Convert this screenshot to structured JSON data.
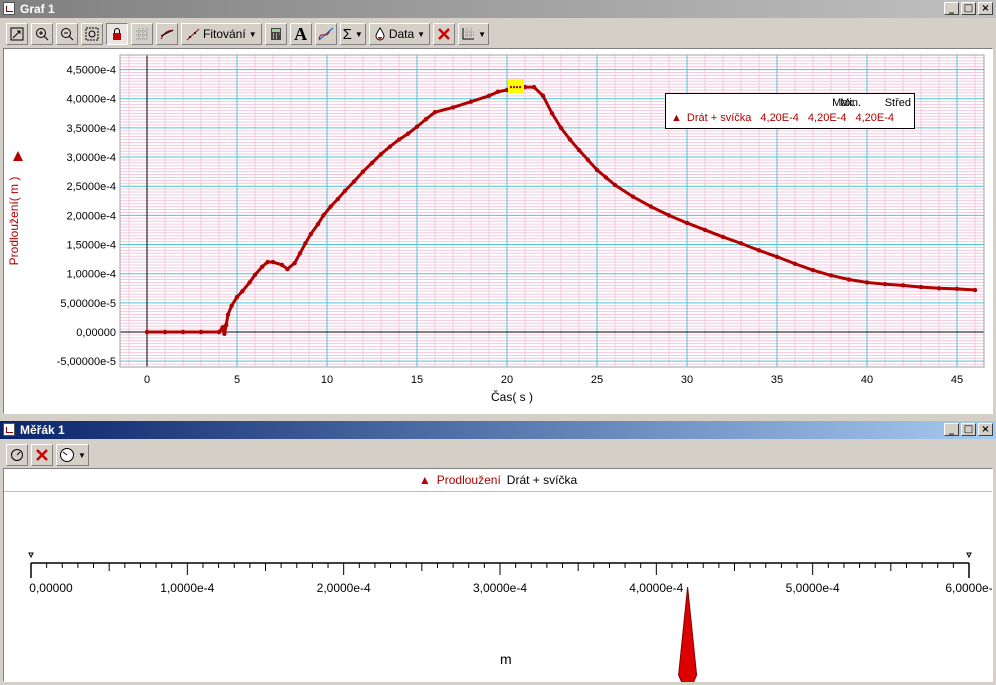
{
  "graf": {
    "title": "Graf 1",
    "window_buttons": [
      "_",
      "□",
      "×"
    ],
    "toolbar": {
      "fitting_label": "Fitování",
      "data_label": "Data",
      "text_tool": "A",
      "sum_tool": "Σ"
    },
    "legend": {
      "headers": [
        "Min.",
        "Max.",
        "Střed"
      ],
      "series_name": "Drát + svíčka",
      "min": "4,20E-4",
      "max": "4,20E-4",
      "mid": "4,20E-4"
    }
  },
  "chart_data": {
    "type": "line",
    "xlabel": "Čas( s )",
    "ylabel": "Prodloužení( m )",
    "xlim": [
      -1.5,
      46.5
    ],
    "ylim": [
      -6e-05,
      0.000475
    ],
    "xticks": [
      0,
      5,
      10,
      15,
      20,
      25,
      30,
      35,
      40,
      45
    ],
    "yticks": [
      -5e-05,
      0,
      5e-05,
      0.0001,
      0.00015,
      0.0002,
      0.00025,
      0.0003,
      0.00035,
      0.0004,
      0.00045
    ],
    "xtick_labels": [
      "0",
      "5",
      "10",
      "15",
      "20",
      "25",
      "30",
      "35",
      "40",
      "45"
    ],
    "ytick_labels": [
      "-5,00000e-5",
      "0,00000",
      "5,00000e-5",
      "1,0000e-4",
      "1,5000e-4",
      "2,0000e-4",
      "2,5000e-4",
      "3,0000e-4",
      "3,5000e-4",
      "4,0000e-4",
      "4,5000e-4"
    ],
    "grid": true,
    "series": [
      {
        "name": "Drát + svíčka",
        "color": "#b00000",
        "x": [
          0,
          1,
          2,
          3,
          4,
          4.2,
          4.3,
          4.4,
          4.5,
          4.7,
          5,
          5.3,
          5.7,
          6,
          6.4,
          6.7,
          7,
          7.5,
          7.8,
          8.2,
          8.5,
          8.8,
          9.1,
          9.5,
          9.8,
          10.2,
          10.6,
          11,
          11.5,
          12,
          12.5,
          13,
          13.5,
          14,
          14.5,
          15,
          15.5,
          16,
          17,
          18,
          19,
          19.5,
          20,
          20.3,
          20.6,
          21,
          21.5,
          22,
          22.5,
          23,
          23.5,
          24,
          24.5,
          25,
          25.5,
          26,
          27,
          28,
          29,
          30,
          31,
          32,
          33,
          34,
          35,
          36,
          37,
          38,
          39,
          40,
          41,
          42,
          43,
          44,
          45,
          46
        ],
        "y": [
          0,
          0,
          0,
          0,
          0,
          8e-06,
          -3e-06,
          1.2e-05,
          3e-05,
          4.5e-05,
          6e-05,
          7e-05,
          8.5e-05,
          9.8e-05,
          0.000112,
          0.00012,
          0.00012,
          0.000115,
          0.000108,
          0.000118,
          0.000135,
          0.000152,
          0.000168,
          0.000185,
          0.0002,
          0.000215,
          0.000228,
          0.000242,
          0.000258,
          0.000275,
          0.00029,
          0.000305,
          0.000318,
          0.00033,
          0.00034,
          0.000352,
          0.000365,
          0.000377,
          0.000385,
          0.000395,
          0.000405,
          0.000412,
          0.000415,
          0.00042,
          0.00042,
          0.00042,
          0.00042,
          0.000405,
          0.000375,
          0.00035,
          0.00033,
          0.000312,
          0.000295,
          0.000278,
          0.000265,
          0.000252,
          0.000232,
          0.000215,
          0.0002,
          0.000187,
          0.000175,
          0.000163,
          0.000152,
          0.00014,
          0.000129,
          0.000117,
          0.000106,
          9.7e-05,
          9e-05,
          8.5e-05,
          8.2e-05,
          8e-05,
          7.7e-05,
          7.5e-05,
          7.4e-05,
          7.2e-05
        ]
      }
    ],
    "highlight_point": {
      "x": 20.5,
      "y": 0.00042,
      "color": "#ffff00"
    }
  },
  "meter": {
    "title": "Měřák 1",
    "window_buttons": [
      "_",
      "□",
      "×"
    ],
    "quantity_label": "Prodloužení",
    "series_name": "Drát + svíčka",
    "unit": "m",
    "scale_min": 0,
    "scale_max": 0.0006,
    "value": 0.00042,
    "tick_values": [
      0,
      0.0001,
      0.0002,
      0.0003,
      0.0004,
      0.0005,
      0.0006
    ],
    "tick_labels": [
      "0,00000",
      "1,0000e-4",
      "2,0000e-4",
      "3,0000e-4",
      "4,0000e-4",
      "5,0000e-4",
      "6,0000e-"
    ]
  },
  "colors": {
    "series": "#b00000",
    "grid": "#4fc3d7",
    "minor_grid": "#f2c8dd",
    "highlight": "#ffff00"
  }
}
